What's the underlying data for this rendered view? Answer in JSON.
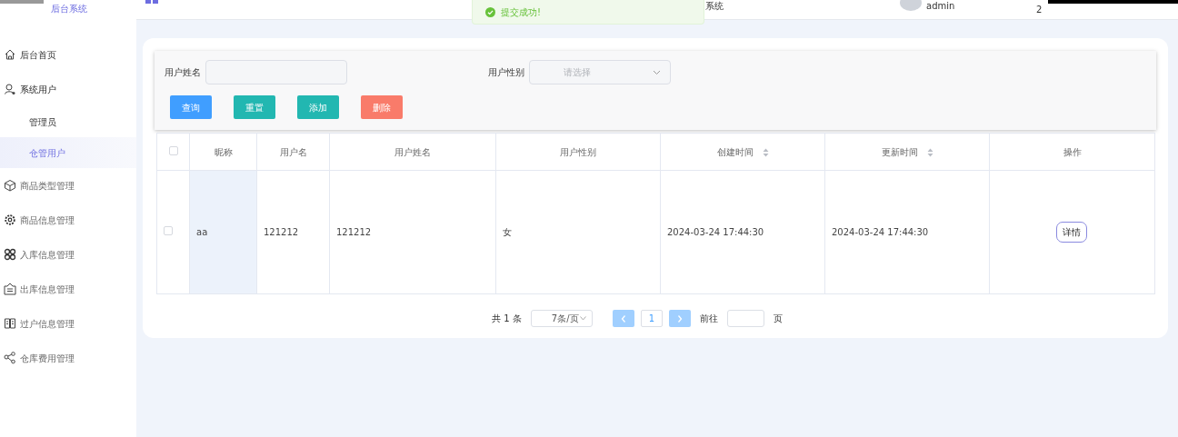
{
  "sidebar": {
    "title": "后台系统",
    "items": [
      {
        "label": "后台首页",
        "selected": false
      },
      {
        "label": "系统用户",
        "selected": false,
        "expanded": true,
        "children": [
          {
            "label": "管理员",
            "selected": false
          },
          {
            "label": "仓管用户",
            "selected": true
          }
        ]
      },
      {
        "label": "商品类型管理",
        "selected": false
      },
      {
        "label": "商品信息管理",
        "selected": false
      },
      {
        "label": "入库信息管理",
        "selected": false
      },
      {
        "label": "出库信息管理",
        "selected": false
      },
      {
        "label": "过户信息管理",
        "selected": false
      },
      {
        "label": "仓库费用管理",
        "selected": false
      }
    ]
  },
  "header": {
    "system_text": "系统",
    "user": "admin",
    "extra": "2"
  },
  "toast": {
    "message": "提交成功!",
    "kind": "success"
  },
  "search": {
    "fields": [
      {
        "label": "用户姓名",
        "kind": "input"
      },
      {
        "label": "用户性别",
        "kind": "select",
        "placeholder": "请选择"
      }
    ],
    "buttons": [
      {
        "label": "查询",
        "kind": "primary"
      },
      {
        "label": "重置",
        "kind": "teal"
      },
      {
        "label": "添加",
        "kind": "teal"
      },
      {
        "label": "删除",
        "kind": "danger"
      }
    ]
  },
  "table": {
    "select_all_checked": false,
    "columns": [
      {
        "label": "昵称",
        "sortable": false
      },
      {
        "label": "用户名",
        "sortable": false
      },
      {
        "label": "用户姓名",
        "sortable": false
      },
      {
        "label": "用户性别",
        "sortable": false
      },
      {
        "label": "创建时间",
        "sortable": true
      },
      {
        "label": "更新时间",
        "sortable": true
      },
      {
        "label": "操作",
        "sortable": false
      }
    ],
    "rows": [
      {
        "checked": false,
        "cells": [
          "aa",
          "121212",
          "121212",
          "女",
          "2024-03-24 17:44:30",
          "2024-03-24 17:44:30"
        ],
        "action": "详情"
      }
    ]
  },
  "pagination": {
    "total": "共 1 条",
    "page_size": "7条/页",
    "pages": [
      {
        "label": "1",
        "selected": true
      }
    ],
    "goto_label": "前往",
    "goto_suffix": "页"
  }
}
